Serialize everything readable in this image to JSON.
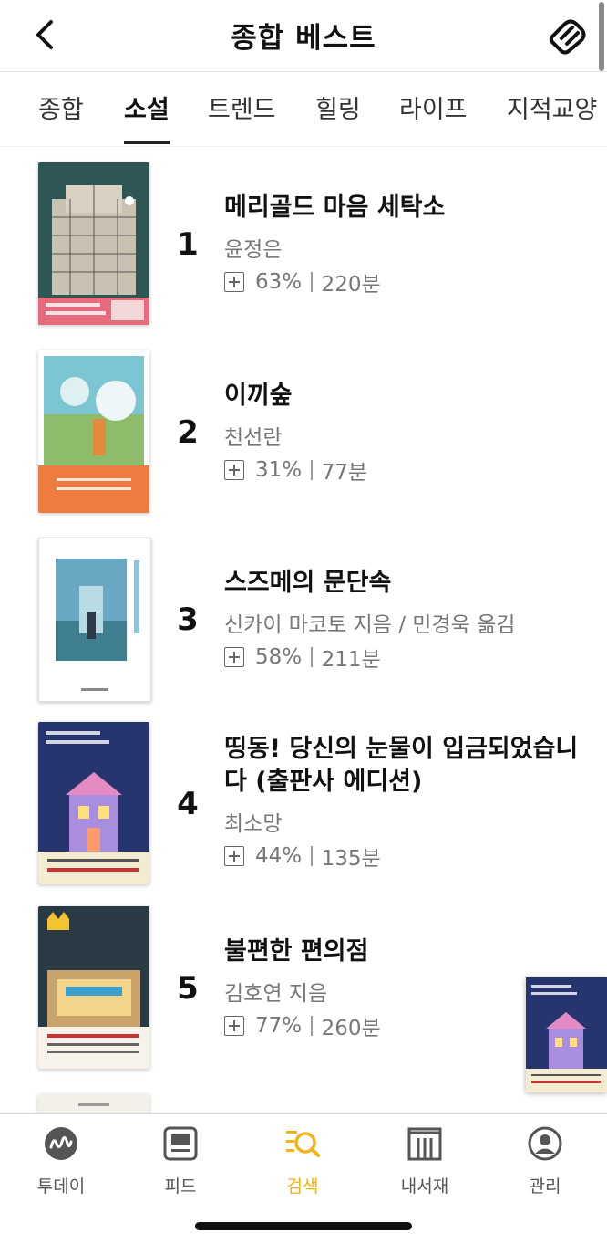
{
  "header": {
    "title": "종합 베스트"
  },
  "tabs": [
    {
      "label": "종합"
    },
    {
      "label": "소설",
      "active": true
    },
    {
      "label": "트렌드"
    },
    {
      "label": "힐링"
    },
    {
      "label": "라이프"
    },
    {
      "label": "지적교양"
    }
  ],
  "books": [
    {
      "rank": "1",
      "title": "메리골드 마음 세탁소",
      "author": "윤정은",
      "progress": "63%",
      "duration": "220분"
    },
    {
      "rank": "2",
      "title": "이끼숲",
      "author": "천선란",
      "progress": "31%",
      "duration": "77분"
    },
    {
      "rank": "3",
      "title": "스즈메의 문단속",
      "author": "신카이 마코토 지음 / 민경욱 옮김",
      "progress": "58%",
      "duration": "211분"
    },
    {
      "rank": "4",
      "title": "띵동! 당신의 눈물이 입금되었습니다 (출판사 에디션)",
      "author": "최소망",
      "progress": "44%",
      "duration": "135분"
    },
    {
      "rank": "5",
      "title": "불편한 편의점",
      "author": "김호연 지음",
      "progress": "77%",
      "duration": "260분"
    }
  ],
  "nav": [
    {
      "label": "투데이"
    },
    {
      "label": "피드"
    },
    {
      "label": "검색",
      "active": true
    },
    {
      "label": "내서재"
    },
    {
      "label": "관리"
    }
  ],
  "colors": {
    "accent": "#f2b21a"
  }
}
